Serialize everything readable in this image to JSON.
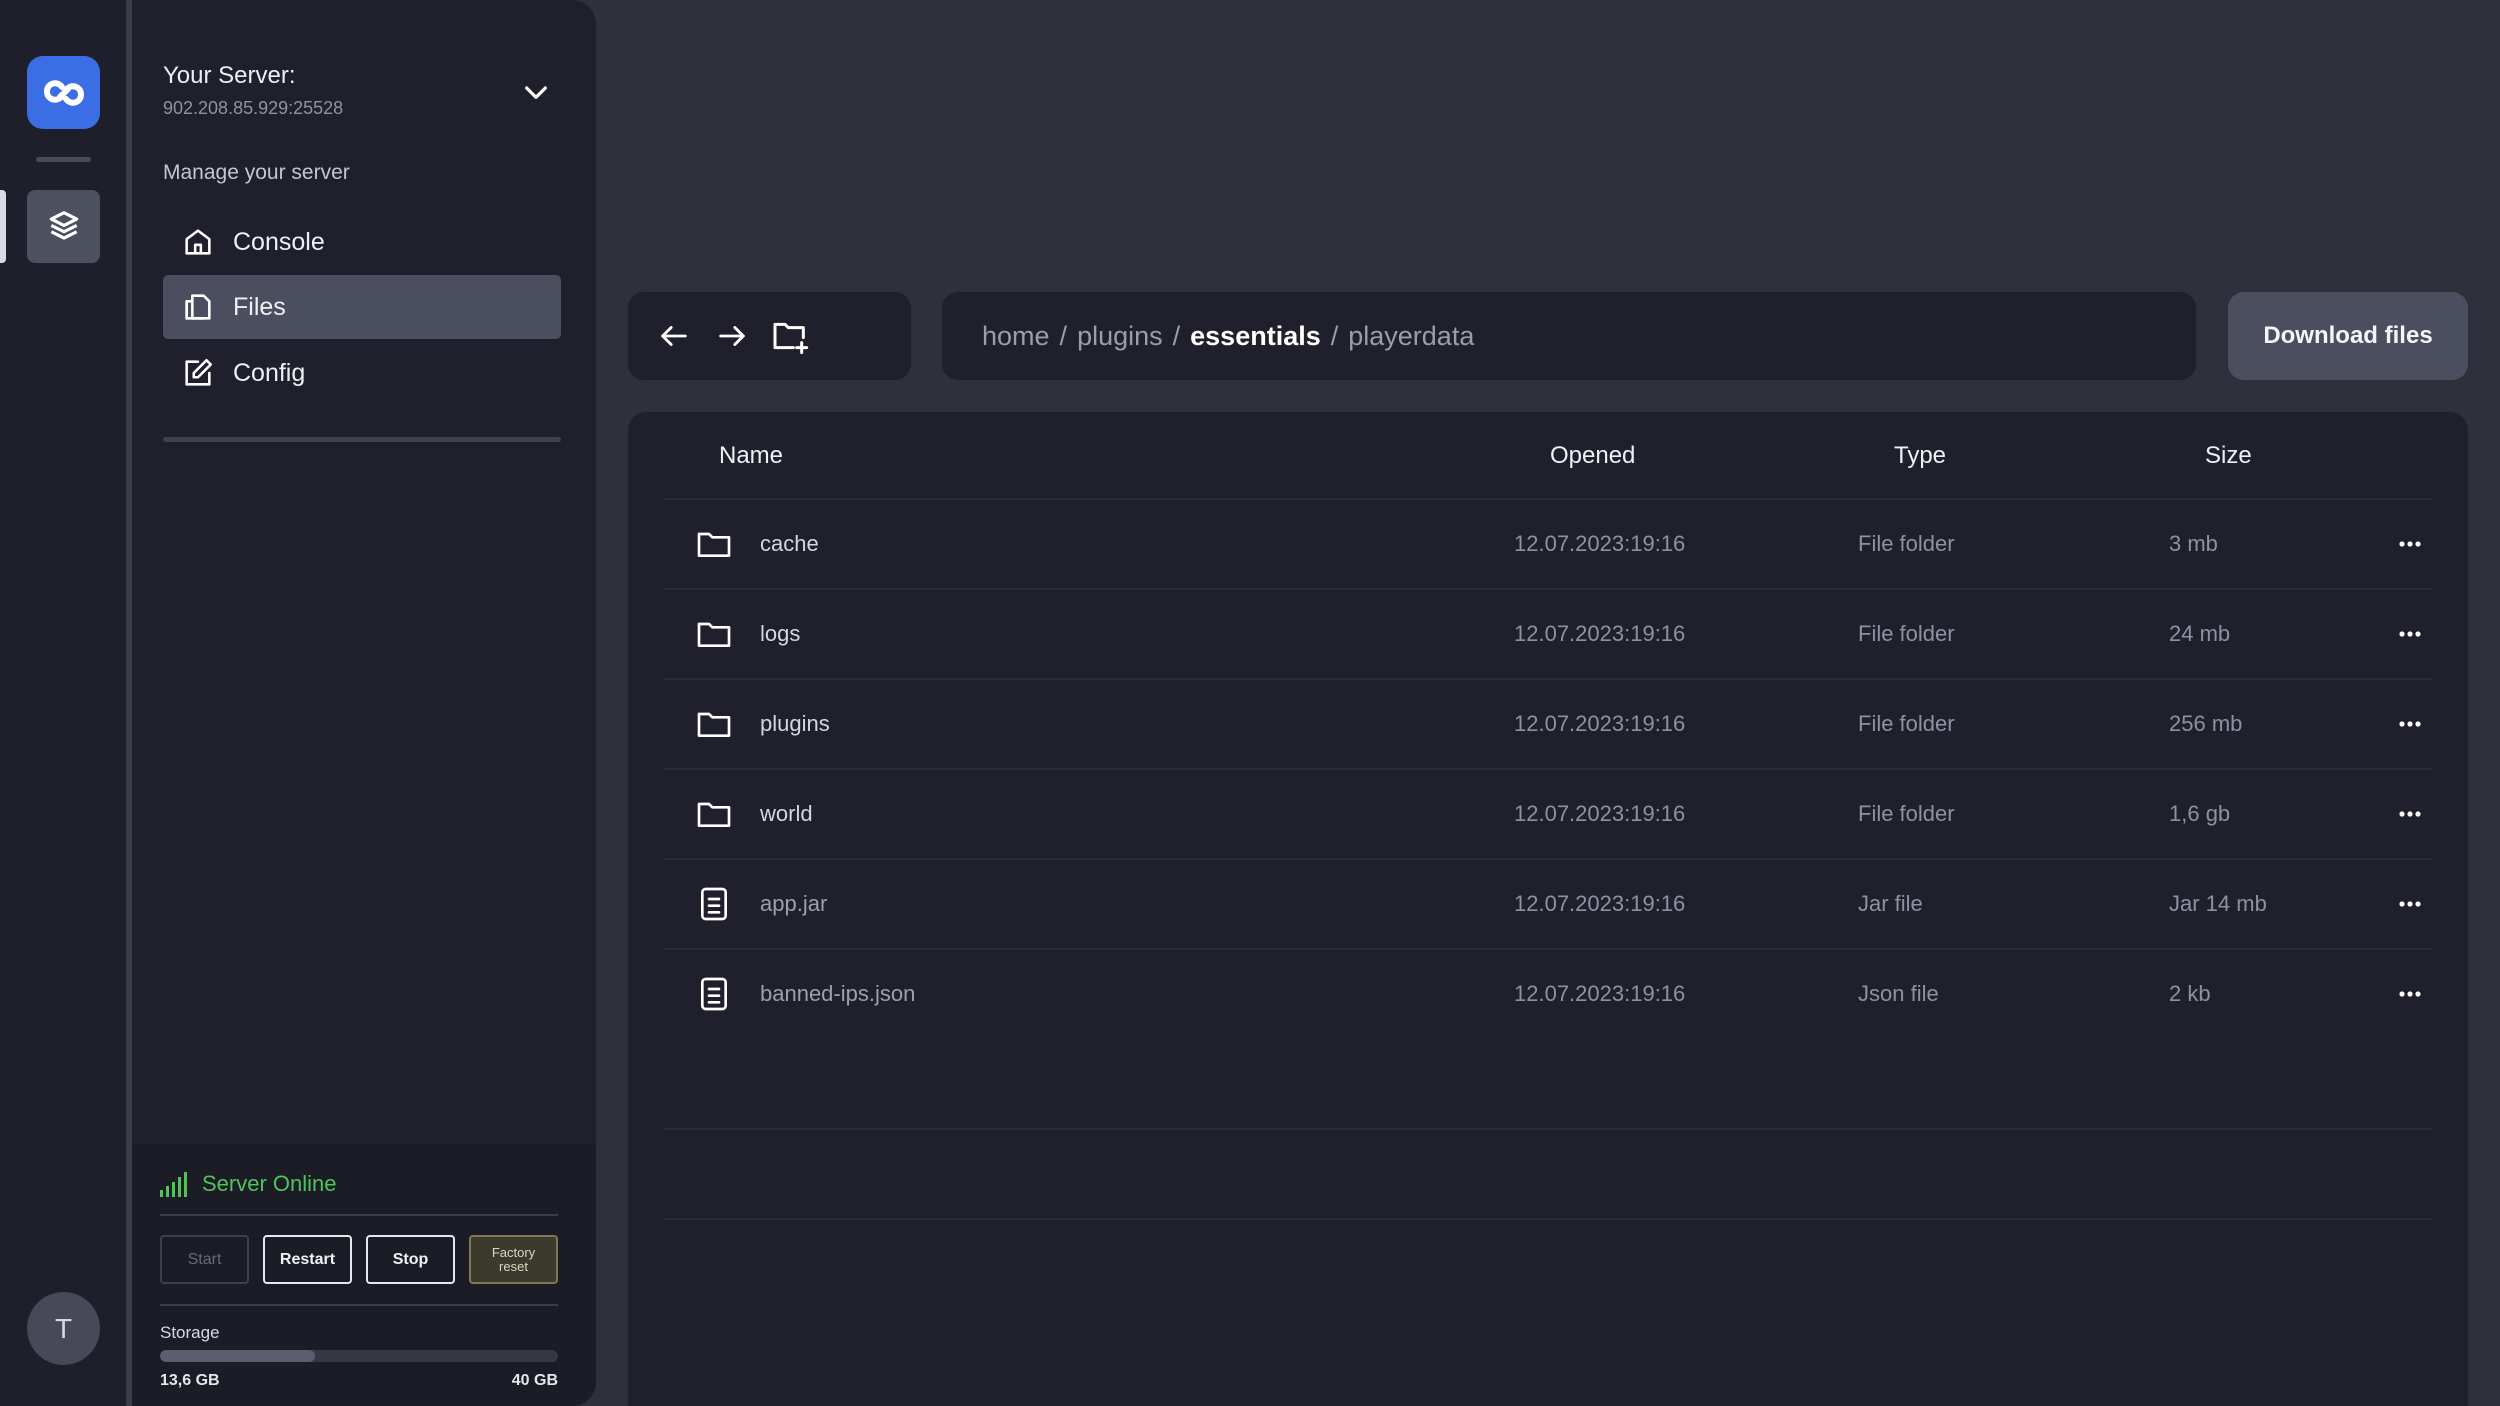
{
  "rail": {
    "logo_icon": "infinity-link-icon",
    "avatar_initial": "T",
    "colors": {
      "logo_bg": "#3b6ee5",
      "rail_bg": "#1e1f2a"
    }
  },
  "sidebar": {
    "server_title": "Your Server:",
    "server_address": "902.208.85.929:25528",
    "manage_label": "Manage your server",
    "nav": [
      {
        "label": "Console",
        "icon": "home-icon",
        "active": false
      },
      {
        "label": "Files",
        "icon": "files-icon",
        "active": true
      },
      {
        "label": "Config",
        "icon": "edit-icon",
        "active": false
      }
    ],
    "status": {
      "label": "Server Online",
      "color": "#4fc45b"
    },
    "controls": {
      "start": "Start",
      "restart": "Restart",
      "stop": "Stop",
      "factory_line1": "Factory",
      "factory_line2": "reset"
    },
    "storage": {
      "label": "Storage",
      "used": "13,6 GB",
      "total": "40 GB",
      "fraction": 0.39
    }
  },
  "toolbar": {
    "path": [
      "home",
      "plugins",
      "essentials",
      "playerdata"
    ],
    "path_separator": "/",
    "download_label": "Download files"
  },
  "table": {
    "headers": {
      "name": "Name",
      "opened": "Opened",
      "type": "Type",
      "size": "Size"
    },
    "rows": [
      {
        "name": "cache",
        "opened": "12.07.2023:19:16",
        "type": "File folder",
        "size": "3 mb",
        "kind": "folder"
      },
      {
        "name": "logs",
        "opened": "12.07.2023:19:16",
        "type": "File folder",
        "size": "24 mb",
        "kind": "folder"
      },
      {
        "name": "plugins",
        "opened": "12.07.2023:19:16",
        "type": "File folder",
        "size": "256 mb",
        "kind": "folder"
      },
      {
        "name": "world",
        "opened": "12.07.2023:19:16",
        "type": "File folder",
        "size": "1,6 gb",
        "kind": "folder"
      },
      {
        "name": "app.jar",
        "opened": "12.07.2023:19:16",
        "type": "Jar file",
        "size": "Jar 14 mb",
        "kind": "file"
      },
      {
        "name": "banned-ips.json",
        "opened": "12.07.2023:19:16",
        "type": "Json file",
        "size": "2 kb",
        "kind": "file"
      }
    ]
  }
}
